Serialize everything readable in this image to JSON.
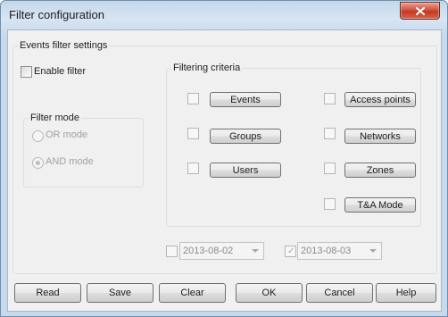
{
  "window": {
    "title": "Filter configuration"
  },
  "events_group": {
    "legend": "Events filter settings",
    "enable_filter": {
      "label": "Enable filter",
      "checked": false
    }
  },
  "filter_mode": {
    "legend": "Filter mode",
    "options": [
      {
        "label": "OR mode",
        "selected": false
      },
      {
        "label": "AND mode",
        "selected": true
      }
    ]
  },
  "filtering_criteria": {
    "legend": "Filtering criteria",
    "left": [
      {
        "label": "Events"
      },
      {
        "label": "Groups"
      },
      {
        "label": "Users"
      }
    ],
    "right": [
      {
        "label": "Access points"
      },
      {
        "label": "Networks"
      },
      {
        "label": "Zones"
      },
      {
        "label": "T&A Mode"
      }
    ]
  },
  "dates": {
    "from": {
      "value": "2013-08-02",
      "checked": false
    },
    "to": {
      "value": "2013-08-03",
      "checked": true
    }
  },
  "buttons": {
    "read": "Read",
    "save": "Save",
    "clear": "Clear",
    "ok": "OK",
    "cancel": "Cancel",
    "help": "Help"
  }
}
